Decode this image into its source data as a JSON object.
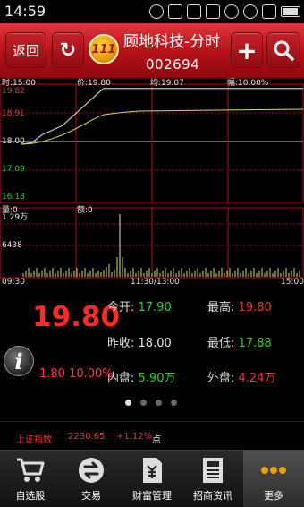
{
  "status_bar": {
    "time": "14:59"
  },
  "header": {
    "back_label": "返回",
    "logo_text": "111",
    "title": "顾地科技-分时",
    "stock_code": "002694"
  },
  "chart_labels": {
    "time_label": "时:15:00",
    "price_label": "价:19.80",
    "avg_label": "均:19.07",
    "range_label": "幅:10.00%",
    "price_axis": [
      "19.82",
      "18.91",
      "18.00",
      "17.09",
      "16.18"
    ],
    "vol_marker": "量:0",
    "amount_marker": "额:0",
    "vol_axis": [
      "1.29万",
      "6438"
    ],
    "time_axis": [
      "09:30",
      "11:30/13:00",
      "15:00"
    ]
  },
  "chart_data": {
    "type": "line",
    "title": "",
    "x": [
      "09:30",
      "11:30/13:00",
      "15:00"
    ],
    "ylim": [
      16.18,
      19.82
    ],
    "series": [
      {
        "name": "价",
        "values": [
          18.0,
          18.05,
          18.3,
          18.45,
          18.6,
          18.9,
          19.2,
          19.5,
          19.8,
          19.8,
          19.8,
          19.8
        ]
      },
      {
        "name": "均",
        "values": [
          18.0,
          18.02,
          18.08,
          18.18,
          18.3,
          18.45,
          18.62,
          18.8,
          18.95,
          19.0,
          19.04,
          19.07
        ]
      }
    ]
  },
  "quote": {
    "price": "19.80",
    "change": "1.80 10.00%",
    "open_label": "今开:",
    "open_value": "17.90",
    "high_label": "最高:",
    "high_value": "19.80",
    "prev_close_label": "昨收:",
    "prev_close_value": "18.00",
    "low_label": "最低:",
    "low_value": "17.88",
    "inner_label": "内盘:",
    "inner_value": "5.90万",
    "outer_label": "外盘:",
    "outer_value": "4.24万"
  },
  "ticker": {
    "index_name": "上证指数",
    "index_value": "2230.65",
    "index_change": "+1.12%",
    "trailing": "点"
  },
  "tabs": [
    {
      "label": "自选股",
      "icon": "cart-icon"
    },
    {
      "label": "交易",
      "icon": "exchange-icon"
    },
    {
      "label": "财富管理",
      "icon": "wealth-icon"
    },
    {
      "label": "招商资讯",
      "icon": "news-icon"
    },
    {
      "label": "更多",
      "icon": "more-icon"
    }
  ],
  "colors": {
    "accent": "#b21117",
    "up": "#e23a3a",
    "down": "#33cc33"
  }
}
